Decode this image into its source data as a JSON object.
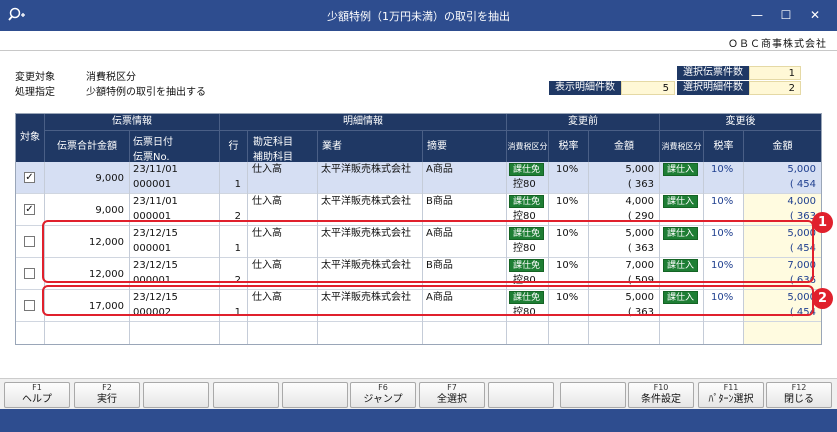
{
  "window": {
    "title": "少額特例（1万円未満）の取引を抽出",
    "min": "—",
    "max": "☐",
    "close": "✕"
  },
  "company": "ＯＢＣ商事株式会社",
  "info": {
    "target_label": "変更対象",
    "target_value": "消費税区分",
    "process_label": "処理指定",
    "process_value": "少額特例の取引を抽出する"
  },
  "counts": {
    "selected_slips_label": "選択伝票件数",
    "selected_slips": "1",
    "shown_lines_label": "表示明細件数",
    "shown_lines": "5",
    "selected_lines_label": "選択明細件数",
    "selected_lines": "2"
  },
  "table": {
    "group_slip": "伝票情報",
    "group_detail": "明細情報",
    "group_before": "変更前",
    "group_after": "変更後",
    "col_target": "対象",
    "col_total": "伝票合計金額",
    "col_date": "伝票日付",
    "col_no": "伝票No.",
    "col_row": "行",
    "col_account": "勘定科目",
    "col_subaccount": "補助科目",
    "col_vendor": "業者",
    "col_memo": "摘要",
    "col_tax_before": "消費税区分",
    "col_rate_before": "税率",
    "col_amount_before": "金額",
    "col_tax_after": "消費税区分",
    "col_rate_after": "税率",
    "col_amount_after": "金額",
    "rows": [
      {
        "checked": "✓",
        "total": "9,000",
        "date": "23/11/01",
        "no": "000001",
        "line": "1",
        "account": "仕入高",
        "vendor": "太平洋販売株式会社",
        "memo": "A商品",
        "tax_before": "課仕免",
        "deduct": "控80",
        "rate_before": "10%",
        "amount_before": "5,000",
        "tax_before_amt": "( 363",
        "tax_after": "課仕入",
        "rate_after": "10%",
        "amount_after": "5,000",
        "tax_after_amt": "( 454"
      },
      {
        "checked": "✓",
        "total": "9,000",
        "date": "23/11/01",
        "no": "000001",
        "line": "2",
        "account": "仕入高",
        "vendor": "太平洋販売株式会社",
        "memo": "B商品",
        "tax_before": "課仕免",
        "deduct": "控80",
        "rate_before": "10%",
        "amount_before": "4,000",
        "tax_before_amt": "( 290",
        "tax_after": "課仕入",
        "rate_after": "10%",
        "amount_after": "4,000",
        "tax_after_amt": "( 363"
      },
      {
        "checked": "",
        "total": "12,000",
        "date": "23/12/15",
        "no": "000001",
        "line": "1",
        "account": "仕入高",
        "vendor": "太平洋販売株式会社",
        "memo": "A商品",
        "tax_before": "課仕免",
        "deduct": "控80",
        "rate_before": "10%",
        "amount_before": "5,000",
        "tax_before_amt": "( 363",
        "tax_after": "課仕入",
        "rate_after": "10%",
        "amount_after": "5,000",
        "tax_after_amt": "( 454"
      },
      {
        "checked": "",
        "total": "12,000",
        "date": "23/12/15",
        "no": "000001",
        "line": "2",
        "account": "仕入高",
        "vendor": "太平洋販売株式会社",
        "memo": "B商品",
        "tax_before": "課仕免",
        "deduct": "控80",
        "rate_before": "10%",
        "amount_before": "7,000",
        "tax_before_amt": "( 509",
        "tax_after": "課仕入",
        "rate_after": "10%",
        "amount_after": "7,000",
        "tax_after_amt": "( 636"
      },
      {
        "checked": "",
        "total": "17,000",
        "date": "23/12/15",
        "no": "000002",
        "line": "1",
        "account": "仕入高",
        "vendor": "太平洋販売株式会社",
        "memo": "A商品",
        "tax_before": "課仕免",
        "deduct": "控80",
        "rate_before": "10%",
        "amount_before": "5,000",
        "tax_before_amt": "( 363",
        "tax_after": "課仕入",
        "rate_after": "10%",
        "amount_after": "5,000",
        "tax_after_amt": "( 454"
      }
    ]
  },
  "badges": {
    "one": "1",
    "two": "2"
  },
  "fkeys": [
    {
      "key": "F1",
      "label": "ヘルプ"
    },
    {
      "key": "F2",
      "label": "実行"
    },
    {
      "key": "",
      "label": ""
    },
    {
      "key": "",
      "label": ""
    },
    {
      "key": "",
      "label": ""
    },
    {
      "key": "F6",
      "label": "ジャンプ"
    },
    {
      "key": "F7",
      "label": "全選択"
    },
    {
      "key": "",
      "label": ""
    },
    {
      "key": "",
      "label": ""
    },
    {
      "key": "F10",
      "label": "条件設定"
    },
    {
      "key": "F11",
      "label": "ﾊﾟﾀｰﾝ選択"
    },
    {
      "key": "F12",
      "label": "閉じる"
    }
  ]
}
